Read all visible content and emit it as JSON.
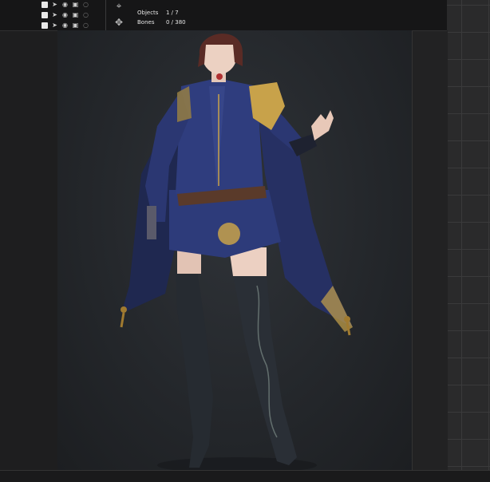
{
  "window": {
    "title": ""
  },
  "layers": [
    {
      "visible": true,
      "locked": false
    },
    {
      "visible": true,
      "locked": false
    },
    {
      "visible": true,
      "locked": false
    }
  ],
  "stats": {
    "objects_label": "Objects",
    "objects_value": "1 / 7",
    "bones_label": "Bones",
    "bones_value": "0 / 380"
  },
  "icons": {
    "layer_check": "checkbox-icon",
    "select": "cursor-icon",
    "visibility": "eye-icon",
    "render": "camera-icon",
    "lock": "lock-icon",
    "transform": "move-icon"
  },
  "colors": {
    "header": "#161617",
    "viewport": "#24272b",
    "coat": "#2a3566",
    "gold": "#c8a24a"
  }
}
